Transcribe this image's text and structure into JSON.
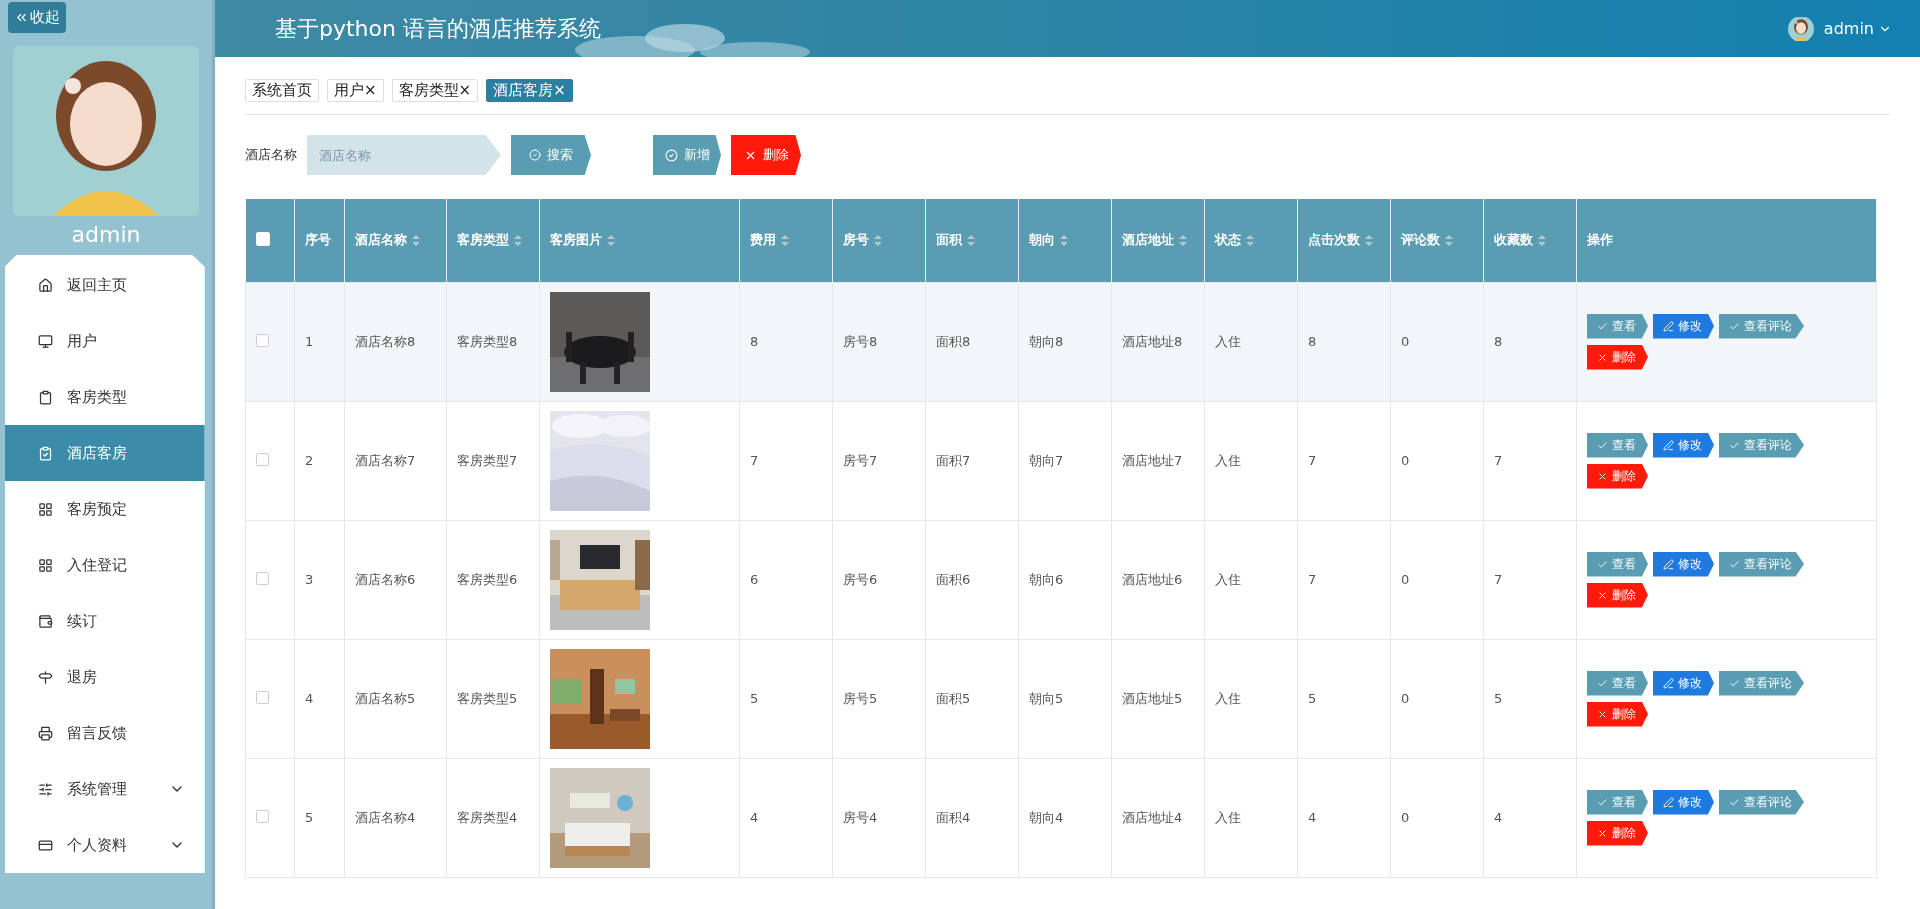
{
  "sidebar": {
    "collapse_button": "收起",
    "user_name": "admin",
    "items": [
      {
        "label": "返回主页",
        "selected": false
      },
      {
        "label": "用户",
        "selected": false
      },
      {
        "label": "客房类型",
        "selected": false
      },
      {
        "label": "酒店客房",
        "selected": true
      },
      {
        "label": "客房预定",
        "selected": false
      },
      {
        "label": "入住登记",
        "selected": false
      },
      {
        "label": "续订",
        "selected": false
      },
      {
        "label": "退房",
        "selected": false
      },
      {
        "label": "留言反馈",
        "selected": false
      },
      {
        "label": "系统管理",
        "selected": false,
        "expanded": false
      },
      {
        "label": "个人资料",
        "selected": false,
        "expanded": false
      }
    ]
  },
  "header": {
    "title": "基于python 语言的酒店推荐系统",
    "user": "admin"
  },
  "tabs": [
    {
      "label": "系统首页",
      "selected": false
    },
    {
      "label": "用户",
      "close": "×",
      "selected": false
    },
    {
      "label": "客房类型",
      "close": "×",
      "selected": false
    },
    {
      "label": "酒店客房",
      "close": "×",
      "selected": true
    }
  ],
  "search": {
    "label": "酒店名称",
    "placeholder": "酒店名称",
    "button": "搜索"
  },
  "actions": [
    {
      "kind": "add",
      "label": "新增"
    },
    {
      "kind": "delete",
      "label": "删除"
    }
  ],
  "table": {
    "select_all": false,
    "columns": [
      {
        "label": "序号",
        "sortable": false
      },
      {
        "label": "酒店名称",
        "sortable": true
      },
      {
        "label": "客房类型",
        "sortable": true
      },
      {
        "label": "客房图片",
        "sortable": true
      },
      {
        "label": "费用",
        "sortable": true
      },
      {
        "label": "房号",
        "sortable": true
      },
      {
        "label": "面积",
        "sortable": true
      },
      {
        "label": "朝向",
        "sortable": true
      },
      {
        "label": "酒店地址",
        "sortable": true
      },
      {
        "label": "状态",
        "sortable": true
      },
      {
        "label": "点击次数",
        "sortable": true
      },
      {
        "label": "评论数",
        "sortable": true
      },
      {
        "label": "收藏数",
        "sortable": true
      },
      {
        "label": "操作",
        "sortable": false
      }
    ],
    "rows": [
      {
        "checked": false,
        "highlighted": true,
        "cells": [
          {
            "text": "1"
          },
          {
            "text": "酒店名称8"
          },
          {
            "text": "客房类型8"
          },
          {
            "kind": "picture"
          },
          {
            "text": "8"
          },
          {
            "text": "房号8"
          },
          {
            "text": "面积8"
          },
          {
            "text": "朝向8"
          },
          {
            "text": "酒店地址8"
          },
          {
            "text": "入住"
          },
          {
            "text": "8"
          },
          {
            "text": "0"
          },
          {
            "text": "8"
          }
        ],
        "buttons": [
          {
            "kind": "view",
            "label": "查看"
          },
          {
            "kind": "edit",
            "label": "修改"
          },
          {
            "kind": "comments",
            "label": "查看评论"
          },
          {
            "kind": "delete",
            "label": "删除"
          }
        ]
      },
      {
        "checked": false,
        "highlighted": false,
        "cells": [
          {
            "text": "2"
          },
          {
            "text": "酒店名称7"
          },
          {
            "text": "客房类型7"
          },
          {
            "kind": "picture"
          },
          {
            "text": "7"
          },
          {
            "text": "房号7"
          },
          {
            "text": "面积7"
          },
          {
            "text": "朝向7"
          },
          {
            "text": "酒店地址7"
          },
          {
            "text": "入住"
          },
          {
            "text": "7"
          },
          {
            "text": "0"
          },
          {
            "text": "7"
          }
        ],
        "buttons": [
          {
            "kind": "view",
            "label": "查看"
          },
          {
            "kind": "edit",
            "label": "修改"
          },
          {
            "kind": "comments",
            "label": "查看评论"
          },
          {
            "kind": "delete",
            "label": "删除"
          }
        ]
      },
      {
        "checked": false,
        "highlighted": false,
        "cells": [
          {
            "text": "3"
          },
          {
            "text": "酒店名称6"
          },
          {
            "text": "客房类型6"
          },
          {
            "kind": "picture"
          },
          {
            "text": "6"
          },
          {
            "text": "房号6"
          },
          {
            "text": "面积6"
          },
          {
            "text": "朝向6"
          },
          {
            "text": "酒店地址6"
          },
          {
            "text": "入住"
          },
          {
            "text": "7"
          },
          {
            "text": "0"
          },
          {
            "text": "7"
          }
        ],
        "buttons": [
          {
            "kind": "view",
            "label": "查看"
          },
          {
            "kind": "edit",
            "label": "修改"
          },
          {
            "kind": "comments",
            "label": "查看评论"
          },
          {
            "kind": "delete",
            "label": "删除"
          }
        ]
      },
      {
        "checked": false,
        "highlighted": false,
        "cells": [
          {
            "text": "4"
          },
          {
            "text": "酒店名称5"
          },
          {
            "text": "客房类型5"
          },
          {
            "kind": "picture"
          },
          {
            "text": "5"
          },
          {
            "text": "房号5"
          },
          {
            "text": "面积5"
          },
          {
            "text": "朝向5"
          },
          {
            "text": "酒店地址5"
          },
          {
            "text": "入住"
          },
          {
            "text": "5"
          },
          {
            "text": "0"
          },
          {
            "text": "5"
          }
        ],
        "buttons": [
          {
            "kind": "view",
            "label": "查看"
          },
          {
            "kind": "edit",
            "label": "修改"
          },
          {
            "kind": "comments",
            "label": "查看评论"
          },
          {
            "kind": "delete",
            "label": "删除"
          }
        ]
      },
      {
        "checked": false,
        "highlighted": false,
        "cells": [
          {
            "text": "5"
          },
          {
            "text": "酒店名称4"
          },
          {
            "text": "客房类型4"
          },
          {
            "kind": "picture"
          },
          {
            "text": "4"
          },
          {
            "text": "房号4"
          },
          {
            "text": "面积4"
          },
          {
            "text": "朝向4"
          },
          {
            "text": "酒店地址4"
          },
          {
            "text": "入住"
          },
          {
            "text": "4"
          },
          {
            "text": "0"
          },
          {
            "text": "4"
          }
        ],
        "buttons": [
          {
            "kind": "view",
            "label": "查看"
          },
          {
            "kind": "edit",
            "label": "修改"
          },
          {
            "kind": "comments",
            "label": "查看评论"
          },
          {
            "kind": "delete",
            "label": "删除"
          }
        ]
      }
    ]
  }
}
